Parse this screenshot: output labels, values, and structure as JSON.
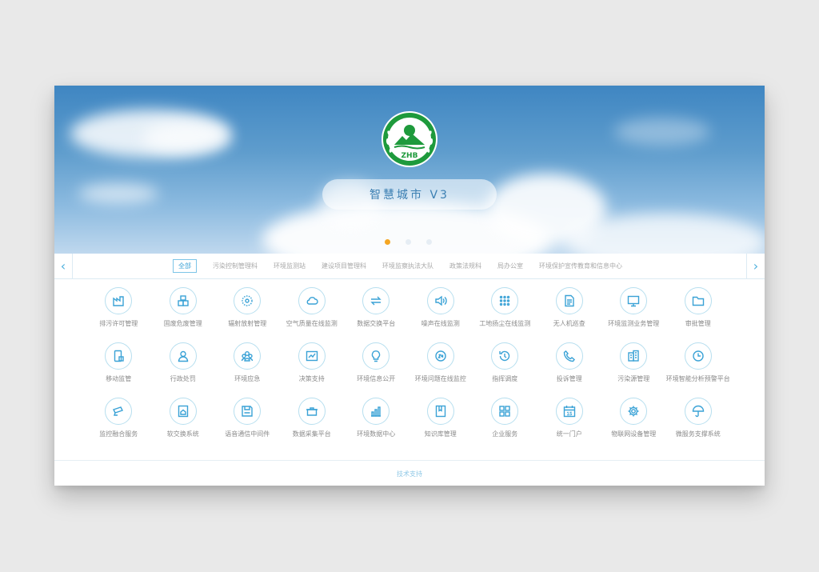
{
  "banner": {
    "title": "智慧城市  V3",
    "logo_text": "ZHB",
    "dots": 3,
    "active_dot": 0
  },
  "tabs": [
    {
      "label": "全部",
      "active": true
    },
    {
      "label": "污染控制管理科",
      "active": false
    },
    {
      "label": "环境监测站",
      "active": false
    },
    {
      "label": "建设项目管理科",
      "active": false
    },
    {
      "label": "环境监察执法大队",
      "active": false
    },
    {
      "label": "政策法规科",
      "active": false
    },
    {
      "label": "局办公室",
      "active": false
    },
    {
      "label": "环境保护宣传教育和信息中心",
      "active": false
    }
  ],
  "apps": [
    {
      "label": "排污许可管理",
      "icon": "factory-icon"
    },
    {
      "label": "固废危废管理",
      "icon": "boxes-icon"
    },
    {
      "label": "辐射放射管理",
      "icon": "radiation-icon"
    },
    {
      "label": "空气质量在线监测",
      "icon": "cloud-icon"
    },
    {
      "label": "数据交换平台",
      "icon": "exchange-icon"
    },
    {
      "label": "噪声在线监测",
      "icon": "speaker-icon"
    },
    {
      "label": "工地扬尘在线监测",
      "icon": "dots-grid-icon"
    },
    {
      "label": "无人机巡查",
      "icon": "document-icon"
    },
    {
      "label": "环境监测业务管理",
      "icon": "monitor-icon"
    },
    {
      "label": "审批管理",
      "icon": "folder-icon"
    },
    {
      "label": "移动监管",
      "icon": "mobile-icon"
    },
    {
      "label": "行政处罚",
      "icon": "user-icon"
    },
    {
      "label": "环境应急",
      "icon": "group-icon"
    },
    {
      "label": "决策支持",
      "icon": "chart-board-icon"
    },
    {
      "label": "环境信息公开",
      "icon": "lightbulb-icon"
    },
    {
      "label": "环境问题在线监控",
      "icon": "24h-icon"
    },
    {
      "label": "指挥调度",
      "icon": "history-icon"
    },
    {
      "label": "投诉管理",
      "icon": "phone-icon"
    },
    {
      "label": "污染源管理",
      "icon": "building-icon"
    },
    {
      "label": "环境智能分析预警平台",
      "icon": "clock-icon"
    },
    {
      "label": "监控融合服务",
      "icon": "camera-icon"
    },
    {
      "label": "软交换系统",
      "icon": "house-doc-icon"
    },
    {
      "label": "语音通信中间件",
      "icon": "floppy-icon"
    },
    {
      "label": "数据采集平台",
      "icon": "pot-icon"
    },
    {
      "label": "环境数据中心",
      "icon": "bar-chart-icon"
    },
    {
      "label": "知识库管理",
      "icon": "book-icon"
    },
    {
      "label": "企业服务",
      "icon": "apps-icon"
    },
    {
      "label": "统一门户",
      "icon": "calendar-icon"
    },
    {
      "label": "物联网设备管理",
      "icon": "gear-icon"
    },
    {
      "label": "微服务支撑系统",
      "icon": "umbrella-icon"
    }
  ],
  "footer": {
    "label": "技术支持"
  },
  "colors": {
    "accent": "#3aa2d6",
    "active_dot": "#f5a623",
    "logo_green": "#1e9a3c"
  }
}
